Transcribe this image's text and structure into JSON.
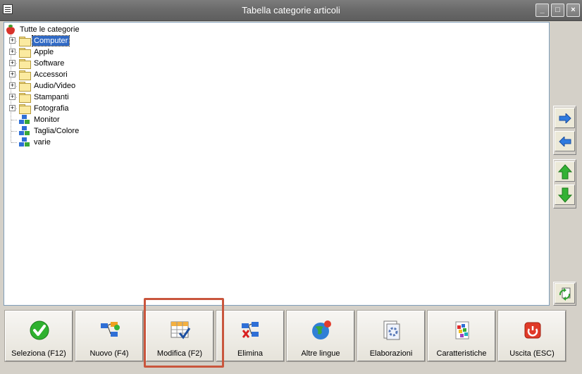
{
  "window": {
    "title": "Tabella categorie articoli",
    "minimize_glyph": "_",
    "maximize_glyph": "□",
    "close_glyph": "×"
  },
  "tree": {
    "root_label": "Tutte le categorie",
    "expand_glyph": "+",
    "items": [
      {
        "label": "Computer",
        "type": "folder",
        "expandable": true,
        "selected": true
      },
      {
        "label": "Apple",
        "type": "folder",
        "expandable": true,
        "selected": false
      },
      {
        "label": "Software",
        "type": "folder",
        "expandable": true,
        "selected": false
      },
      {
        "label": "Accessori",
        "type": "folder",
        "expandable": true,
        "selected": false
      },
      {
        "label": "Audio/Video",
        "type": "folder",
        "expandable": true,
        "selected": false
      },
      {
        "label": "Stampanti",
        "type": "folder",
        "expandable": true,
        "selected": false
      },
      {
        "label": "Fotografia",
        "type": "folder",
        "expandable": true,
        "selected": false
      },
      {
        "label": "Monitor",
        "type": "leaf",
        "expandable": false,
        "selected": false
      },
      {
        "label": "Taglia/Colore",
        "type": "leaf",
        "expandable": false,
        "selected": false
      },
      {
        "label": "varie",
        "type": "leaf",
        "expandable": false,
        "selected": false
      }
    ]
  },
  "actions": [
    {
      "label": "Seleziona (F12)",
      "icon": "check-icon"
    },
    {
      "label": "Nuovo (F4)",
      "icon": "new-node-icon"
    },
    {
      "label": "Modifica (F2)",
      "icon": "edit-grid-icon"
    },
    {
      "label": "Elimina",
      "icon": "delete-node-icon"
    },
    {
      "label": "Altre lingue",
      "icon": "globe-icon"
    },
    {
      "label": "Elaborazioni",
      "icon": "process-document-icon"
    },
    {
      "label": "Caratteristiche",
      "icon": "features-icon"
    },
    {
      "label": "Uscita (ESC)",
      "icon": "power-icon"
    }
  ],
  "colors": {
    "selection": "#316ac5",
    "highlight_border": "#c9563d",
    "arrow_blue": "#2f7be0",
    "arrow_green": "#34b234"
  }
}
